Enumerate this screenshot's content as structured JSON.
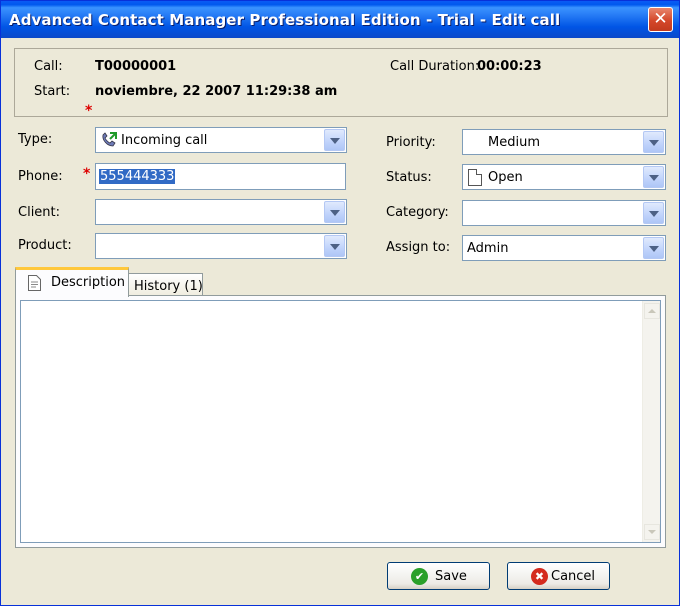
{
  "window": {
    "title": "Advanced Contact Manager  Professional Edition - Trial -  Edit call",
    "close_glyph": "✕"
  },
  "info": {
    "call_label": "Call:",
    "call_value": "T00000001",
    "start_label": "Start:",
    "start_value": "noviembre, 22 2007 11:29:38 am",
    "duration_label": "Call Duration:",
    "duration_value": "00:00:23"
  },
  "required_marker": "*",
  "fields": {
    "type": {
      "label": "Type:",
      "value": "Incoming call",
      "icon": "incoming-call-icon"
    },
    "phone": {
      "label": "Phone:",
      "value": "555444333"
    },
    "client": {
      "label": "Client:",
      "value": ""
    },
    "product": {
      "label": "Product:",
      "value": ""
    },
    "priority": {
      "label": "Priority:",
      "value": "Medium"
    },
    "status": {
      "label": "Status:",
      "value": "Open",
      "icon": "document-icon"
    },
    "category": {
      "label": "Category:",
      "value": ""
    },
    "assign_to": {
      "label": "Assign to:",
      "value": "Admin"
    }
  },
  "tabs": [
    {
      "label": "Description",
      "active": true,
      "icon": "description-icon"
    },
    {
      "label": "History (1)",
      "active": false
    }
  ],
  "buttons": {
    "save": {
      "label": "Save",
      "icon": "check-icon",
      "color": "#2aa02a"
    },
    "cancel": {
      "label": "Cancel",
      "icon": "cancel-icon",
      "color": "#d42b1e"
    }
  },
  "colors": {
    "titlebar": "#0058ee",
    "required": "#dd0000",
    "selection": "#316ac5",
    "active_tab_accent": "#ffc83c"
  }
}
